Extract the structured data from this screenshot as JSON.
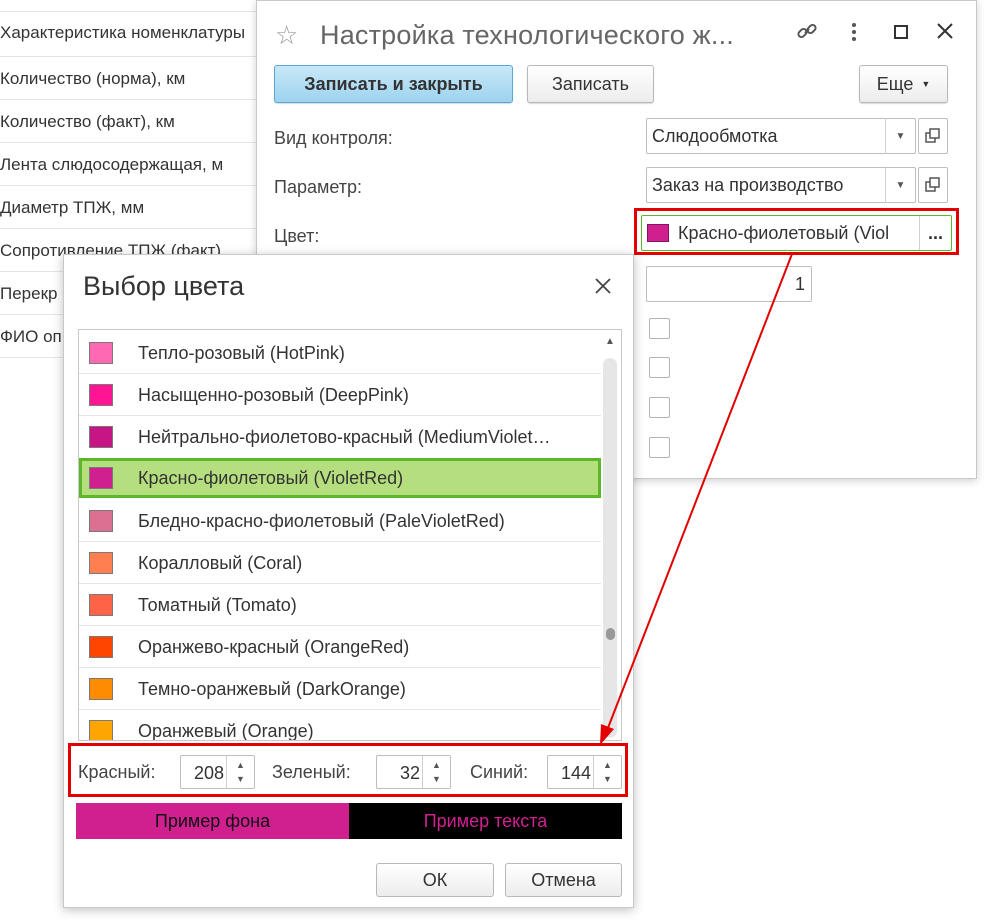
{
  "background_list": {
    "rows": [
      "Характеристика номенклатуры",
      "Количество (норма), км",
      "Количество (факт), км",
      "Лента слюдосодержащая, м",
      "Диаметр ТПЖ, мм",
      "Сопротивление ТПЖ (факт)",
      "Перекр",
      "ФИО оп"
    ]
  },
  "settings_window": {
    "title": "Настройка технологического ж...",
    "buttons": {
      "save_close": "Записать и закрыть",
      "save": "Записать",
      "more": "Еще"
    },
    "fields": {
      "control_type_label": "Вид контроля:",
      "control_type_value": "Слюдообмотка",
      "parameter_label": "Параметр:",
      "parameter_value": "Заказ на производство",
      "color_label": "Цвет:",
      "color_value": "Красно-фиолетовый (Viol",
      "number_value": "1"
    },
    "icons": [
      "star-icon",
      "link-icon",
      "more-vert-icon",
      "maximize-icon",
      "close-icon"
    ]
  },
  "color_dialog": {
    "title": "Выбор цвета",
    "items": [
      {
        "label": "Тепло-розовый (HotPink)",
        "color": "#ff69b4"
      },
      {
        "label": "Насыщенно-розовый (DeepPink)",
        "color": "#ff1493"
      },
      {
        "label": "Нейтрально-фиолетово-красный (MediumViolet…",
        "color": "#c71585"
      },
      {
        "label": "Красно-фиолетовый (VioletRed)",
        "color": "#d02090",
        "selected": true
      },
      {
        "label": "Бледно-красно-фиолетовый (PaleVioletRed)",
        "color": "#db7093"
      },
      {
        "label": "Коралловый (Coral)",
        "color": "#ff7f50"
      },
      {
        "label": "Томатный (Tomato)",
        "color": "#ff6347"
      },
      {
        "label": "Оранжево-красный (OrangeRed)",
        "color": "#ff4500"
      },
      {
        "label": "Темно-оранжевый (DarkOrange)",
        "color": "#ff8c00"
      },
      {
        "label": "Оранжевый (Orange)",
        "color": "#ffa500"
      }
    ],
    "rgb": {
      "red_label": "Красный:",
      "red": "208",
      "green_label": "Зеленый:",
      "green": "32",
      "blue_label": "Синий:",
      "blue": "144"
    },
    "preview": {
      "background_label": "Пример фона",
      "text_label": "Пример текста"
    },
    "buttons": {
      "ok": "ОК",
      "cancel": "Отмена"
    }
  },
  "colors": {
    "selected_color": "#d02090",
    "highlight": "#b5df7f",
    "annotation_red": "#e30000"
  }
}
